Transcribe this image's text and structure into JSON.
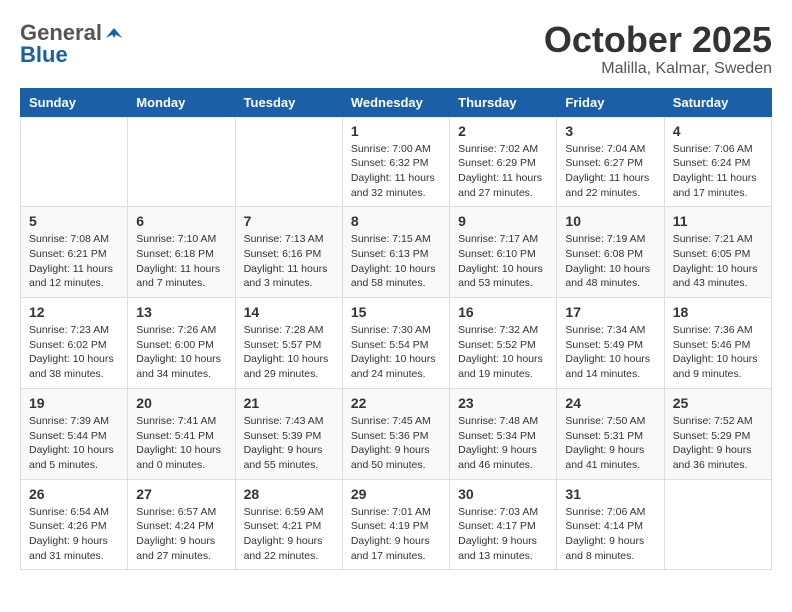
{
  "logo": {
    "general": "General",
    "blue": "Blue"
  },
  "header": {
    "month": "October 2025",
    "location": "Malilla, Kalmar, Sweden"
  },
  "weekdays": [
    "Sunday",
    "Monday",
    "Tuesday",
    "Wednesday",
    "Thursday",
    "Friday",
    "Saturday"
  ],
  "weeks": [
    [
      {
        "day": "",
        "info": ""
      },
      {
        "day": "",
        "info": ""
      },
      {
        "day": "",
        "info": ""
      },
      {
        "day": "1",
        "info": "Sunrise: 7:00 AM\nSunset: 6:32 PM\nDaylight: 11 hours\nand 32 minutes."
      },
      {
        "day": "2",
        "info": "Sunrise: 7:02 AM\nSunset: 6:29 PM\nDaylight: 11 hours\nand 27 minutes."
      },
      {
        "day": "3",
        "info": "Sunrise: 7:04 AM\nSunset: 6:27 PM\nDaylight: 11 hours\nand 22 minutes."
      },
      {
        "day": "4",
        "info": "Sunrise: 7:06 AM\nSunset: 6:24 PM\nDaylight: 11 hours\nand 17 minutes."
      }
    ],
    [
      {
        "day": "5",
        "info": "Sunrise: 7:08 AM\nSunset: 6:21 PM\nDaylight: 11 hours\nand 12 minutes."
      },
      {
        "day": "6",
        "info": "Sunrise: 7:10 AM\nSunset: 6:18 PM\nDaylight: 11 hours\nand 7 minutes."
      },
      {
        "day": "7",
        "info": "Sunrise: 7:13 AM\nSunset: 6:16 PM\nDaylight: 11 hours\nand 3 minutes."
      },
      {
        "day": "8",
        "info": "Sunrise: 7:15 AM\nSunset: 6:13 PM\nDaylight: 10 hours\nand 58 minutes."
      },
      {
        "day": "9",
        "info": "Sunrise: 7:17 AM\nSunset: 6:10 PM\nDaylight: 10 hours\nand 53 minutes."
      },
      {
        "day": "10",
        "info": "Sunrise: 7:19 AM\nSunset: 6:08 PM\nDaylight: 10 hours\nand 48 minutes."
      },
      {
        "day": "11",
        "info": "Sunrise: 7:21 AM\nSunset: 6:05 PM\nDaylight: 10 hours\nand 43 minutes."
      }
    ],
    [
      {
        "day": "12",
        "info": "Sunrise: 7:23 AM\nSunset: 6:02 PM\nDaylight: 10 hours\nand 38 minutes."
      },
      {
        "day": "13",
        "info": "Sunrise: 7:26 AM\nSunset: 6:00 PM\nDaylight: 10 hours\nand 34 minutes."
      },
      {
        "day": "14",
        "info": "Sunrise: 7:28 AM\nSunset: 5:57 PM\nDaylight: 10 hours\nand 29 minutes."
      },
      {
        "day": "15",
        "info": "Sunrise: 7:30 AM\nSunset: 5:54 PM\nDaylight: 10 hours\nand 24 minutes."
      },
      {
        "day": "16",
        "info": "Sunrise: 7:32 AM\nSunset: 5:52 PM\nDaylight: 10 hours\nand 19 minutes."
      },
      {
        "day": "17",
        "info": "Sunrise: 7:34 AM\nSunset: 5:49 PM\nDaylight: 10 hours\nand 14 minutes."
      },
      {
        "day": "18",
        "info": "Sunrise: 7:36 AM\nSunset: 5:46 PM\nDaylight: 10 hours\nand 9 minutes."
      }
    ],
    [
      {
        "day": "19",
        "info": "Sunrise: 7:39 AM\nSunset: 5:44 PM\nDaylight: 10 hours\nand 5 minutes."
      },
      {
        "day": "20",
        "info": "Sunrise: 7:41 AM\nSunset: 5:41 PM\nDaylight: 10 hours\nand 0 minutes."
      },
      {
        "day": "21",
        "info": "Sunrise: 7:43 AM\nSunset: 5:39 PM\nDaylight: 9 hours\nand 55 minutes."
      },
      {
        "day": "22",
        "info": "Sunrise: 7:45 AM\nSunset: 5:36 PM\nDaylight: 9 hours\nand 50 minutes."
      },
      {
        "day": "23",
        "info": "Sunrise: 7:48 AM\nSunset: 5:34 PM\nDaylight: 9 hours\nand 46 minutes."
      },
      {
        "day": "24",
        "info": "Sunrise: 7:50 AM\nSunset: 5:31 PM\nDaylight: 9 hours\nand 41 minutes."
      },
      {
        "day": "25",
        "info": "Sunrise: 7:52 AM\nSunset: 5:29 PM\nDaylight: 9 hours\nand 36 minutes."
      }
    ],
    [
      {
        "day": "26",
        "info": "Sunrise: 6:54 AM\nSunset: 4:26 PM\nDaylight: 9 hours\nand 31 minutes."
      },
      {
        "day": "27",
        "info": "Sunrise: 6:57 AM\nSunset: 4:24 PM\nDaylight: 9 hours\nand 27 minutes."
      },
      {
        "day": "28",
        "info": "Sunrise: 6:59 AM\nSunset: 4:21 PM\nDaylight: 9 hours\nand 22 minutes."
      },
      {
        "day": "29",
        "info": "Sunrise: 7:01 AM\nSunset: 4:19 PM\nDaylight: 9 hours\nand 17 minutes."
      },
      {
        "day": "30",
        "info": "Sunrise: 7:03 AM\nSunset: 4:17 PM\nDaylight: 9 hours\nand 13 minutes."
      },
      {
        "day": "31",
        "info": "Sunrise: 7:06 AM\nSunset: 4:14 PM\nDaylight: 9 hours\nand 8 minutes."
      },
      {
        "day": "",
        "info": ""
      }
    ]
  ]
}
